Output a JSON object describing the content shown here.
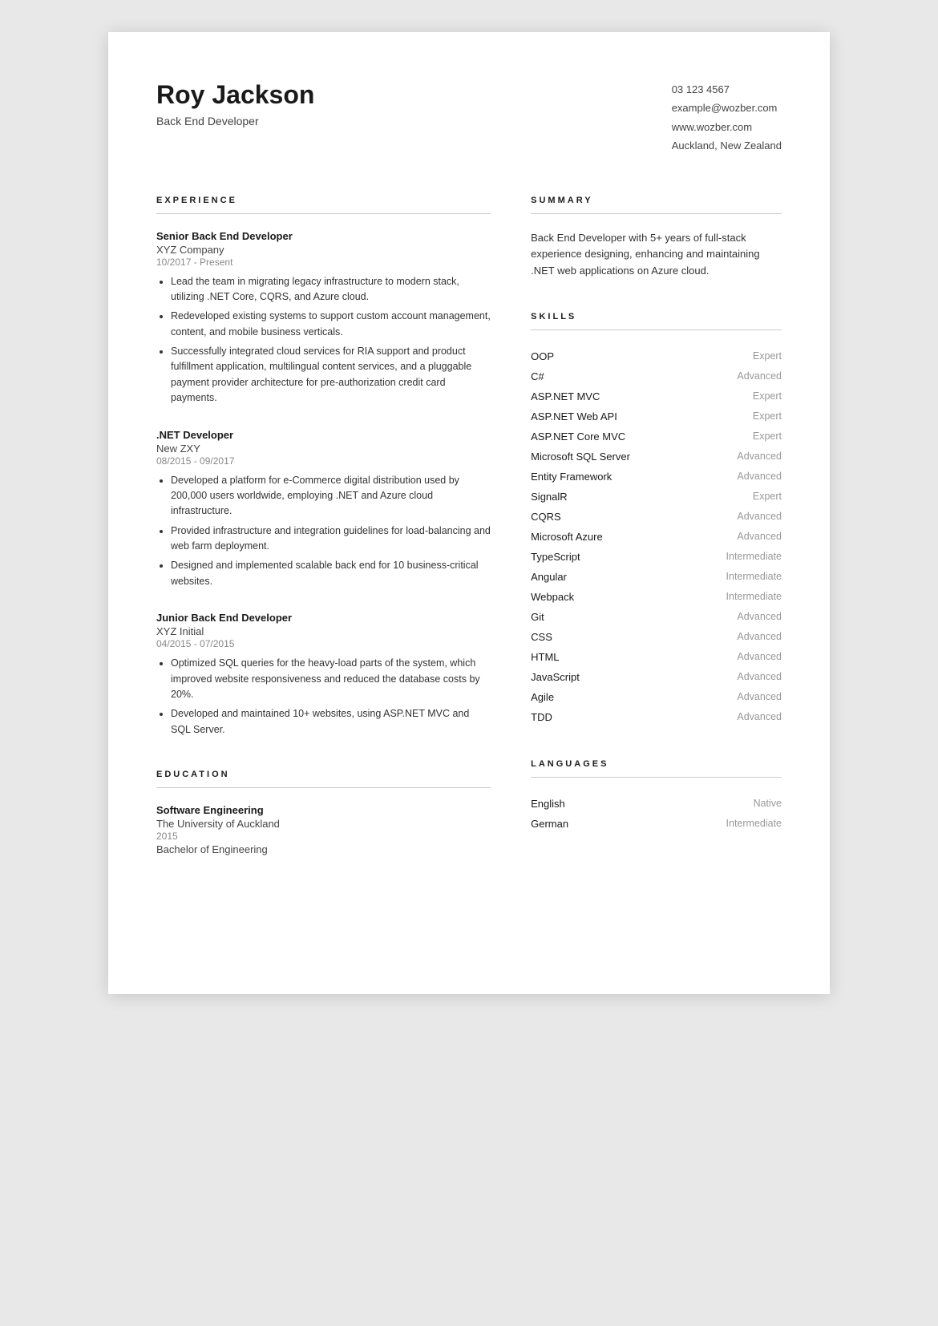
{
  "header": {
    "name": "Roy Jackson",
    "title": "Back End Developer",
    "phone": "03 123 4567",
    "email": "example@wozber.com",
    "website": "www.wozber.com",
    "location": "Auckland, New Zealand"
  },
  "sections": {
    "experience_label": "EXPERIENCE",
    "summary_label": "SUMMARY",
    "skills_label": "SKILLS",
    "education_label": "EDUCATION",
    "languages_label": "LANGUAGES"
  },
  "experience": [
    {
      "job_title": "Senior Back End Developer",
      "company": "XYZ Company",
      "dates": "10/2017 - Present",
      "bullets": [
        "Lead the team in migrating legacy infrastructure to modern stack, utilizing .NET Core, CQRS, and Azure cloud.",
        "Redeveloped existing systems to support custom account management, content, and mobile business verticals.",
        "Successfully integrated cloud services for RIA support and product fulfillment application, multilingual content services, and a pluggable payment provider architecture for pre-authorization credit card payments."
      ]
    },
    {
      "job_title": ".NET Developer",
      "company": "New ZXY",
      "dates": "08/2015 - 09/2017",
      "bullets": [
        "Developed a platform for e-Commerce digital distribution used by 200,000 users worldwide, employing .NET and Azure cloud infrastructure.",
        "Provided infrastructure and integration guidelines for load-balancing and web farm deployment.",
        "Designed and implemented scalable back end for 10 business-critical websites."
      ]
    },
    {
      "job_title": "Junior Back End Developer",
      "company": "XYZ Initial",
      "dates": "04/2015 - 07/2015",
      "bullets": [
        "Optimized SQL queries for the heavy-load parts of the system, which improved website responsiveness and reduced the database costs by 20%.",
        "Developed and maintained 10+ websites, using ASP.NET MVC and SQL Server."
      ]
    }
  ],
  "summary": {
    "text": "Back End Developer with 5+ years of full-stack experience designing, enhancing and maintaining .NET web applications on Azure cloud."
  },
  "skills": [
    {
      "name": "OOP",
      "level": "Expert"
    },
    {
      "name": "C#",
      "level": "Advanced"
    },
    {
      "name": "ASP.NET MVC",
      "level": "Expert"
    },
    {
      "name": "ASP.NET Web API",
      "level": "Expert"
    },
    {
      "name": "ASP.NET Core MVC",
      "level": "Expert"
    },
    {
      "name": "Microsoft SQL Server",
      "level": "Advanced"
    },
    {
      "name": "Entity Framework",
      "level": "Advanced"
    },
    {
      "name": "SignalR",
      "level": "Expert"
    },
    {
      "name": "CQRS",
      "level": "Advanced"
    },
    {
      "name": "Microsoft Azure",
      "level": "Advanced"
    },
    {
      "name": "TypeScript",
      "level": "Intermediate"
    },
    {
      "name": "Angular",
      "level": "Intermediate"
    },
    {
      "name": "Webpack",
      "level": "Intermediate"
    },
    {
      "name": "Git",
      "level": "Advanced"
    },
    {
      "name": "CSS",
      "level": "Advanced"
    },
    {
      "name": "HTML",
      "level": "Advanced"
    },
    {
      "name": "JavaScript",
      "level": "Advanced"
    },
    {
      "name": "Agile",
      "level": "Advanced"
    },
    {
      "name": "TDD",
      "level": "Advanced"
    }
  ],
  "education": [
    {
      "degree": "Software Engineering",
      "school": "The University of Auckland",
      "year": "2015",
      "type": "Bachelor of Engineering"
    }
  ],
  "languages": [
    {
      "name": "English",
      "level": "Native"
    },
    {
      "name": "German",
      "level": "Intermediate"
    }
  ]
}
